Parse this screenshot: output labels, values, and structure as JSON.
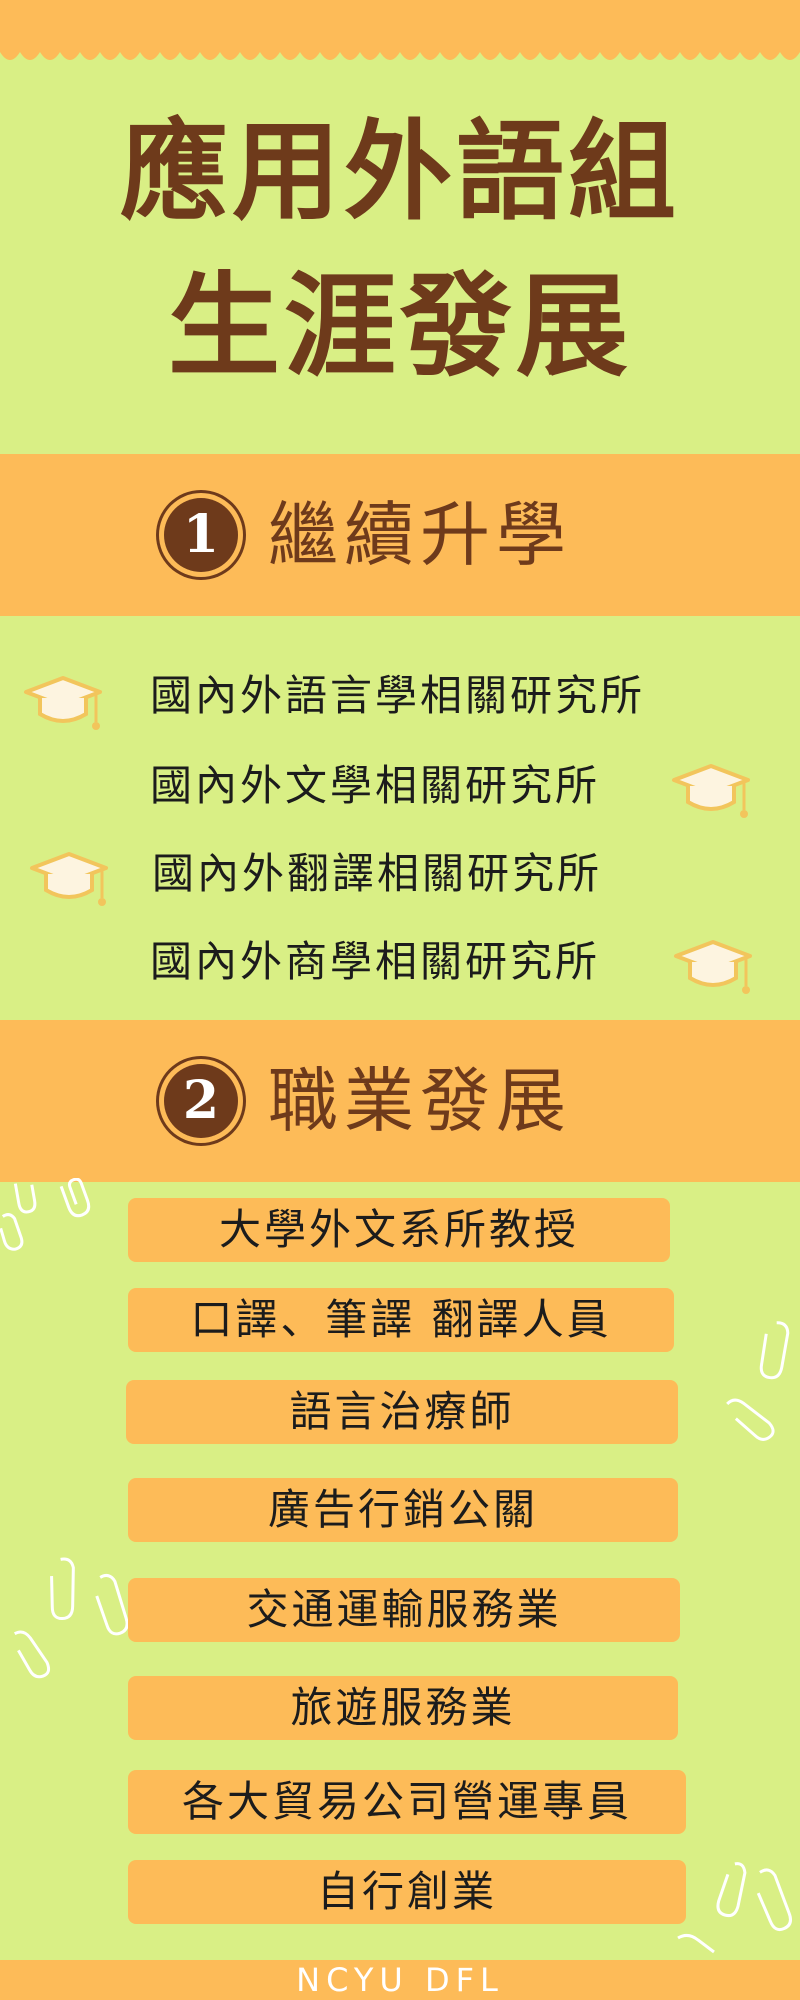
{
  "poster": {
    "title_line1": "應用外語組",
    "title_line2": "生涯發展"
  },
  "section1": {
    "number": "1",
    "title": "繼續升學",
    "items": [
      "國內外語言學相關研究所",
      "國內外文學相關研究所",
      "國內外翻譯相關研究所",
      "國內外商學相關研究所"
    ]
  },
  "section2": {
    "number": "2",
    "title": "職業發展",
    "items": [
      "大學外文系所教授",
      "口譯、筆譯 翻譯人員",
      "語言治療師",
      "廣告行銷公關",
      "交通運輸服務業",
      "旅遊服務業",
      "各大貿易公司營運專員",
      "自行創業"
    ]
  },
  "footer": {
    "text": "NCYU DFL"
  },
  "icons": {
    "cap": "graduation-cap-icon",
    "clip": "paperclip-icon"
  },
  "colors": {
    "background": "#d9ef85",
    "accent": "#fdbb58",
    "title_brown": "#6e3a1b",
    "cap_fill": "#fdf4e0",
    "cap_outline": "#f2c55c",
    "clip": "#ffffff"
  }
}
